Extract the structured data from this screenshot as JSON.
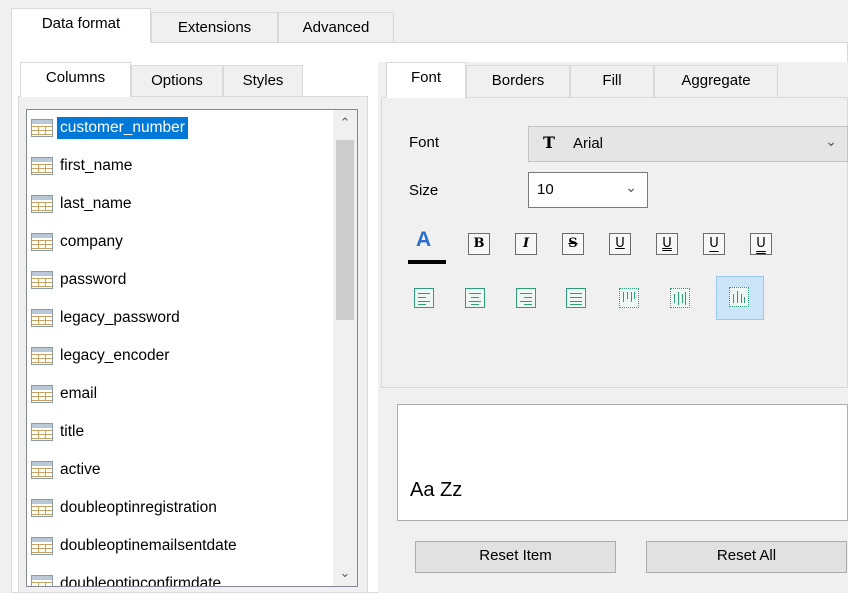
{
  "top_tabs": [
    {
      "label": "Data format"
    },
    {
      "label": "Extensions"
    },
    {
      "label": "Advanced"
    }
  ],
  "left_tabs": [
    {
      "label": "Columns"
    },
    {
      "label": "Options"
    },
    {
      "label": "Styles"
    }
  ],
  "columns": [
    "customer_number",
    "first_name",
    "last_name",
    "company",
    "password",
    "legacy_password",
    "legacy_encoder",
    "email",
    "title",
    "active",
    "doubleoptinregistration",
    "doubleoptinemailsentdate",
    "doubleoptinconfirmdate"
  ],
  "selected_column": "customer_number",
  "right_tabs": [
    {
      "label": "Font"
    },
    {
      "label": "Borders"
    },
    {
      "label": "Fill"
    },
    {
      "label": "Aggregate"
    }
  ],
  "font": {
    "label": "Font",
    "value": "Arial",
    "icon": "truetype-font-icon"
  },
  "size": {
    "label": "Size",
    "value": "10"
  },
  "format_buttons": [
    "font-color",
    "bold",
    "italic",
    "strikeout",
    "underline",
    "double-underline",
    "accounting-underline",
    "double-accounting-underline"
  ],
  "format_glyphs": {
    "bold": "B",
    "italic": "I",
    "strike": "S",
    "u1": "U",
    "u2": "U",
    "u3": "U",
    "u4": "U",
    "color": "A"
  },
  "alignment_buttons": [
    "align-left",
    "align-center",
    "align-right",
    "align-justify",
    "valign-top",
    "valign-center",
    "valign-bottom"
  ],
  "active_alignment": "valign-bottom",
  "preview_text": "Aa Zz",
  "buttons": {
    "reset_item": "Reset Item",
    "reset_all": "Reset All"
  },
  "colors": {
    "selection": "#0078d7",
    "font_color_bar": "#000000",
    "align_icon": "#2e9e7a",
    "active_align_bg": "#cce4f7"
  }
}
